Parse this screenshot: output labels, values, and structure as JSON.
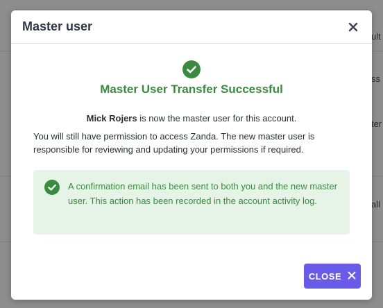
{
  "background": {
    "fragments": [
      "ult",
      "ss",
      "ter",
      "all"
    ]
  },
  "modal": {
    "title": "Master user",
    "success_title": "Master User Transfer Successful",
    "new_master_name": "Mick Rojers",
    "statement_suffix": " is now the master user for this account.",
    "permission_text": "You will still have permission to access Zanda. The new master user is responsible for reviewing and updating your permissions if required.",
    "notice_text": "A confirmation email has been sent to both you and the new master user. This action has been recorded in the account activity log.",
    "close_label": "CLOSE"
  },
  "colors": {
    "success_green": "#3a8a3f",
    "notice_bg": "#e6f4e7",
    "accent_purple": "#6a5ae8"
  },
  "icons": {
    "header_close": "close-icon",
    "success": "check-circle-icon",
    "notice": "check-circle-icon",
    "button_close": "close-icon"
  }
}
